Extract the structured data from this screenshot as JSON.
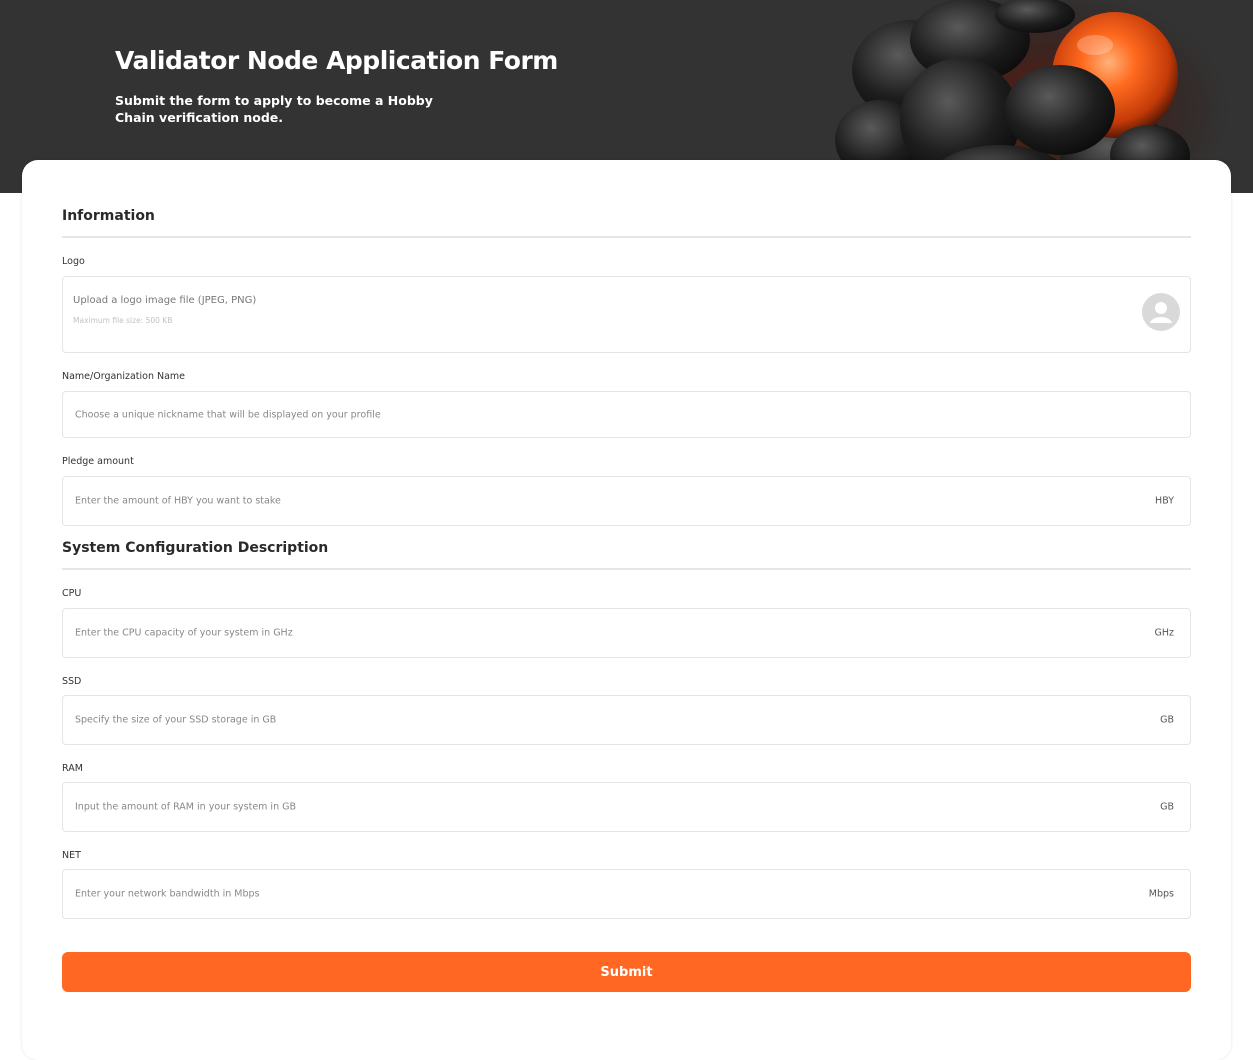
{
  "header": {
    "title": "Validator Node Application Form",
    "subtitle": "Submit the form to apply to become a Hobby Chain verification node."
  },
  "colors": {
    "header_bg": "#333333",
    "accent": "#ff6722",
    "card_bg": "#ffffff"
  },
  "sections": {
    "information": "Information",
    "system": "System Configuration Description"
  },
  "logo": {
    "label": "Logo",
    "placeholder": "Upload a logo image file (JPEG, PNG)",
    "hint": "Maximum file size: 500 KB",
    "icon": "user-avatar-icon"
  },
  "name": {
    "label": "Name/Organization Name",
    "placeholder": "Choose a unique nickname that will be displayed on your profile"
  },
  "pledge": {
    "label": "Pledge amount",
    "placeholder": "Enter the amount of HBY you want to stake",
    "unit": "HBY"
  },
  "cpu": {
    "label": "CPU",
    "placeholder": "Enter the CPU capacity of your system in GHz",
    "unit": "GHz"
  },
  "ssd": {
    "label": "SSD",
    "placeholder": "Specify the size of your SSD storage in GB",
    "unit": "GB"
  },
  "ram": {
    "label": "RAM",
    "placeholder": "Input the amount of RAM in your system in GB",
    "unit": "GB"
  },
  "net": {
    "label": "NET",
    "placeholder": "Enter your network bandwidth in Mbps",
    "unit": "Mbps"
  },
  "submit_label": "Submit"
}
